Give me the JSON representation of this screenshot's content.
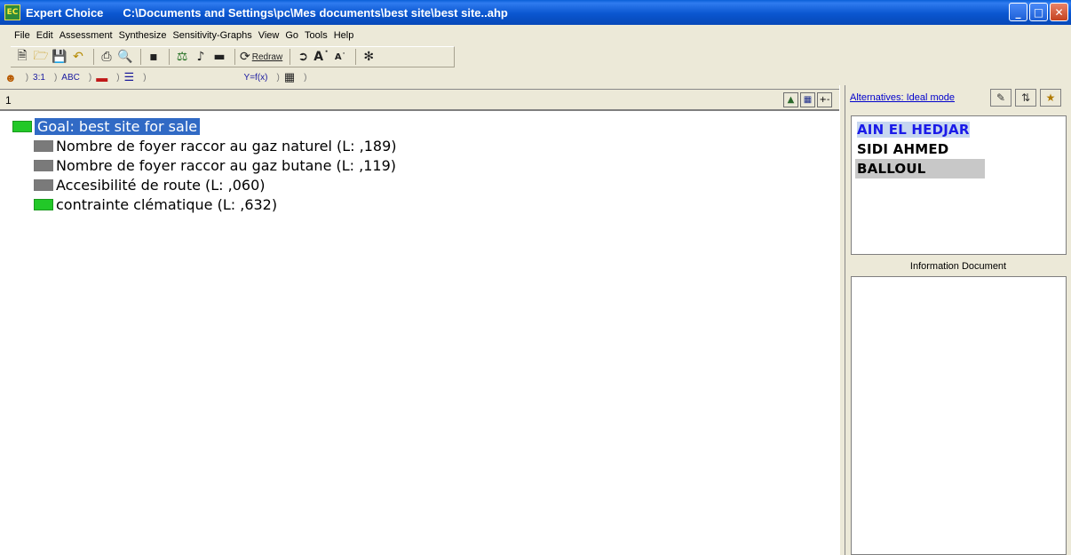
{
  "titlebar": {
    "app_icon_text": "EC",
    "app_name": "Expert Choice",
    "file_path": "C:\\Documents and Settings\\pc\\Mes documents\\best site\\best site..ahp",
    "minimize": "_",
    "maximize": "□",
    "close": "✕"
  },
  "menu": {
    "items": [
      "File",
      "Edit",
      "Assessment",
      "Synthesize",
      "Sensitivity-Graphs",
      "View",
      "Go",
      "Tools",
      "Help"
    ]
  },
  "toolbar": {
    "redraw_label": "Redraw",
    "icons": [
      "new-icon",
      "open-icon",
      "save-icon",
      "undo-icon",
      "print-icon",
      "print-preview-icon",
      "hierarchy-icon",
      "balance-icon",
      "music-icon",
      "frame-icon",
      "redraw-icon",
      "model-icon",
      "font-larger-icon",
      "font-smaller-icon",
      "help-icon"
    ]
  },
  "tabstrip": {
    "tabs": [
      "",
      "3:1",
      "ABC",
      "",
      "",
      "Y=f(x)",
      ""
    ]
  },
  "leftpane": {
    "header_number": "1",
    "goal_label": "Goal: best site for sale",
    "criteria": [
      {
        "label": "Nombre de foyer raccor au gaz naturel (L: ,189)",
        "color": "gray"
      },
      {
        "label": "Nombre de foyer raccor au gaz butane (L: ,119)",
        "color": "gray"
      },
      {
        "label": "Accesibilité de route (L: ,060)",
        "color": "gray"
      },
      {
        "label": "contrainte clématique (L: ,632)",
        "color": "green"
      }
    ]
  },
  "rightpane": {
    "alternatives_link": "Alternatives: Ideal mode",
    "alternatives": [
      "AIN EL HEDJAR",
      "SIDI AHMED",
      "BALLOUL"
    ],
    "info_label": "Information Document"
  },
  "colors": {
    "titlebar_blue": "#0a56d0",
    "selection_blue": "#316ac5",
    "green_node": "#22c828",
    "gray_node": "#7a7a7a",
    "window_bg": "#ece9d8"
  }
}
